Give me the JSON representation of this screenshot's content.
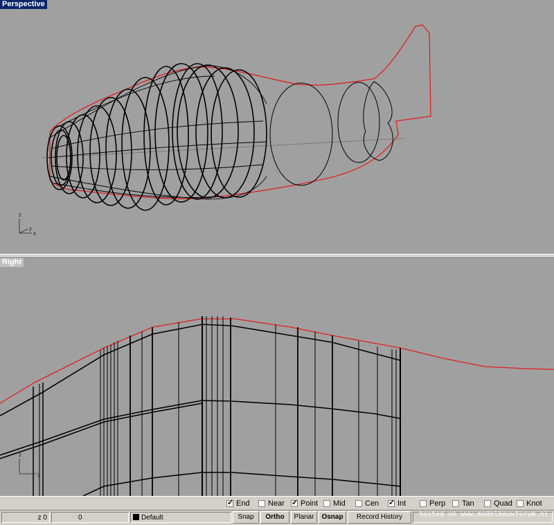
{
  "viewports": {
    "perspective": {
      "title": "Perspective",
      "axis_labels": {
        "vertical": "z",
        "horizontal": "x",
        "depth": "y"
      }
    },
    "right": {
      "title": "Right",
      "axis_labels": {
        "vertical": "z",
        "horizontal": "y"
      }
    }
  },
  "osnap": {
    "items": [
      {
        "label": "End",
        "checked": true
      },
      {
        "label": "Near",
        "checked": false
      },
      {
        "label": "Point",
        "checked": true
      },
      {
        "label": "Mid",
        "checked": false
      },
      {
        "label": "Cen",
        "checked": false
      },
      {
        "label": "Int",
        "checked": true
      },
      {
        "label": "Perp",
        "checked": false
      },
      {
        "label": "Tan",
        "checked": false
      },
      {
        "label": "Quad",
        "checked": false
      },
      {
        "label": "Knot",
        "checked": false
      }
    ]
  },
  "status": {
    "z_coord": "z 0",
    "value": "0",
    "layer": "Default",
    "panes": {
      "snap": "Snap",
      "ortho": "Ortho",
      "planar": "Planar",
      "osnap": "Osnap",
      "record_history": "Record History"
    },
    "watermark": "hosted on www.modelbouwforum.nl"
  },
  "colors": {
    "viewport_bg": "#a0a0a0",
    "outline": "#e02020",
    "wire": "#000000",
    "active_title": "#0a246a"
  }
}
